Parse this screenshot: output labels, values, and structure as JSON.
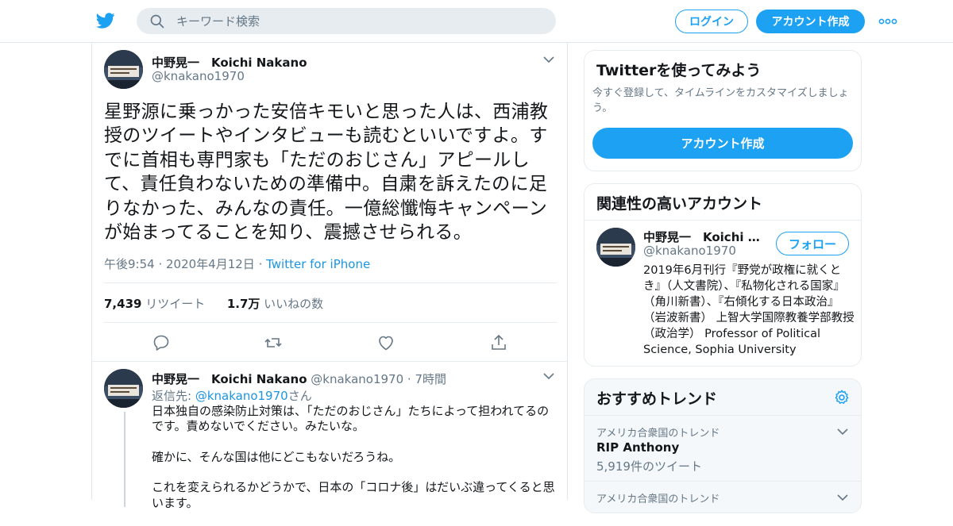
{
  "header": {
    "search_placeholder": "キーワード検索",
    "login_label": "ログイン",
    "signup_label": "アカウント作成"
  },
  "tweet": {
    "author_name": "中野晃一　Koichi Nakano",
    "author_handle": "@knakano1970",
    "text": "星野源に乗っかった安倍キモいと思った人は、西浦教授のツイートやインタビューも読むといいですよ。すでに首相も専門家も「ただのおじさん」アピールして、責任負わないための準備中。自粛を訴えたのに足りなかった、みんなの責任。一億総懺悔キャンペーンが始まってることを知り、震撼させられる。",
    "timestamp": "午後9:54 · 2020年4月12日",
    "meta_sep": " · ",
    "source": "Twitter for iPhone",
    "retweets": "7,439",
    "retweets_label": "リツイート",
    "likes": "1.7万",
    "likes_label": "いいねの数"
  },
  "reply": {
    "author_name": "中野晃一　Koichi Nakano",
    "author_handle": "@knakano1970",
    "time": "· 7時間",
    "reply_to_prefix": "返信先: ",
    "reply_to_handle": "@knakano1970",
    "reply_to_suffix": "さん",
    "paragraphs": [
      "日本独自の感染防止対策は、「ただのおじさん」たちによって担われてるのです。責めないでください。みたいな。",
      "確かに、そんな国は他にどこもないだろうね。",
      "これを変えられるかどうかで、日本の「コロナ後」はだいぶ違ってくると思います。"
    ]
  },
  "sidebar": {
    "signup_card": {
      "title": "Twitterを使ってみよう",
      "subtitle": "今すぐ登録して、タイムラインをカスタマイズしましょう。",
      "button": "アカウント作成"
    },
    "related": {
      "title": "関連性の高いアカウント",
      "name": "中野晃一　Koichi Nakano",
      "handle": "@knakano1970",
      "follow_label": "フォロー",
      "bio": "2019年6月刊行『野党が政権に就くとき』（人文書院）、『私物化される国家』（角川新書）、『右傾化する日本政治』（岩波新書） 上智大学国際教養学部教授（政治学） Professor of Political Science, Sophia University"
    },
    "trends": {
      "title": "おすすめトレンド",
      "items": [
        {
          "context": "アメリカ合衆国のトレンド",
          "name": "RIP Anthony",
          "count": "5,919件のツイート"
        },
        {
          "context": "アメリカ合衆国のトレンド",
          "name": "",
          "count": ""
        }
      ]
    }
  },
  "colors": {
    "accent": "#1da1f2",
    "link": "#1b95e0",
    "muted": "#657786",
    "border": "#e6ecf0"
  },
  "icons": [
    "twitter-bird-icon",
    "search-icon",
    "more-icon",
    "chevron-down-icon",
    "reply-icon",
    "retweet-icon",
    "like-icon",
    "share-icon",
    "gear-icon"
  ]
}
